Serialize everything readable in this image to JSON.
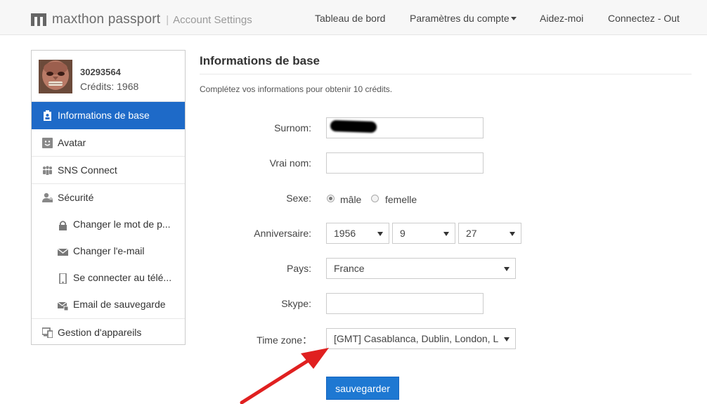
{
  "header": {
    "brand": "maxthon passport",
    "separator": "|",
    "subtitle": "Account Settings",
    "nav": [
      {
        "label": "Tableau de bord"
      },
      {
        "label": "Paramètres du compte"
      },
      {
        "label": "Aidez-moi"
      },
      {
        "label": "Connectez - Out"
      }
    ]
  },
  "profile": {
    "user_id": "30293564",
    "credits": "Crédits: 1968"
  },
  "sidebar": {
    "items": [
      {
        "label": "Informations de base",
        "icon": "id-card-icon"
      },
      {
        "label": "Avatar",
        "icon": "smiley-icon"
      },
      {
        "label": "SNS Connect",
        "icon": "people-icon"
      },
      {
        "label": "Sécurité",
        "icon": "user-lock-icon"
      }
    ],
    "security_sub": [
      {
        "label": "Changer le mot de p...",
        "icon": "lock-icon"
      },
      {
        "label": "Changer l'e-mail",
        "icon": "envelope-icon"
      },
      {
        "label": "Se connecter au télé...",
        "icon": "phone-icon"
      },
      {
        "label": "Email de sauvegarde",
        "icon": "envelope-backup-icon"
      }
    ],
    "devices": {
      "label": "Gestion d'appareils",
      "icon": "devices-icon"
    }
  },
  "main": {
    "title": "Informations de base",
    "intro": "Complétez vos informations pour obtenir 10 crédits.",
    "fields": {
      "nickname_label": "Surnom:",
      "realname_label": "Vrai nom:",
      "gender_label": "Sexe:",
      "gender_male": "mâle",
      "gender_female": "femelle",
      "gender_selected": "male",
      "birthday_label": "Anniversaire:",
      "birth_year": "1956",
      "birth_month": "9",
      "birth_day": "27",
      "country_label": "Pays:",
      "country": "France",
      "skype_label": "Skype:",
      "timezone_label": "Time zone：",
      "timezone": "[GMT] Casablanca, Dublin, London, L"
    },
    "save_label": "sauvegarder"
  },
  "colors": {
    "active_menu": "#1e6ac8",
    "save_button": "#1e78d2",
    "annotation_arrow": "#e02020"
  }
}
